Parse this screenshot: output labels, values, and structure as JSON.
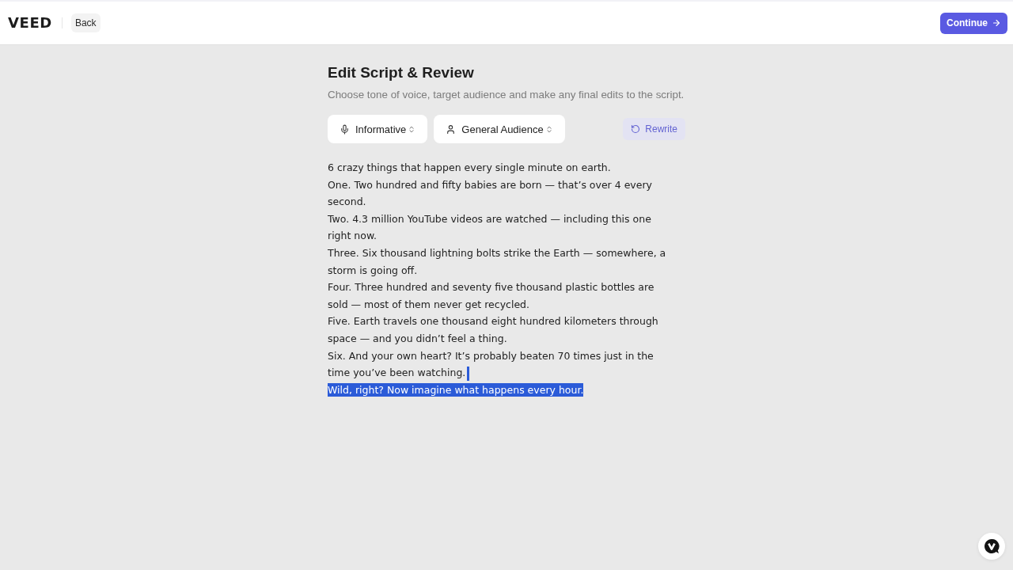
{
  "header": {
    "logo": "VEED",
    "back_button": "Back",
    "continue_button": "Continue"
  },
  "page": {
    "title": "Edit Script & Review",
    "subtitle": "Choose tone of voice, target audience and make any final edits to the script."
  },
  "selects": [
    {
      "kind": "tone",
      "value": "Informative"
    },
    {
      "kind": "audience",
      "value": "General Audience"
    }
  ],
  "rewrite_button": "Rewrite",
  "script": {
    "paragraphs": [
      {
        "text": "6 crazy things that happen every single minute on earth.",
        "selected": false
      },
      {
        "text": "One. Two hundred and fifty babies are born — that’s over 4 every second.",
        "selected": false
      },
      {
        "text": "Two. 4.3 million YouTube videos are watched — including this one right now.",
        "selected": false
      },
      {
        "text": "Three. Six thousand lightning bolts strike the Earth — somewhere, a storm is going off.",
        "selected": false
      },
      {
        "text": "Four. Three hundred and seventy five thousand plastic bottles are sold — most of them never get recycled.",
        "selected": false
      },
      {
        "text": "Five. Earth travels one thousand eight hundred kilometers through space — and you didn’t feel a thing.",
        "selected": false
      },
      {
        "text": "Six. And your own heart? It’s probably beaten 70 times just in the time you’ve been watching.",
        "selected": false
      },
      {
        "text": "Wild, right? Now imagine what happens every hour.",
        "selected": true
      }
    ]
  }
}
